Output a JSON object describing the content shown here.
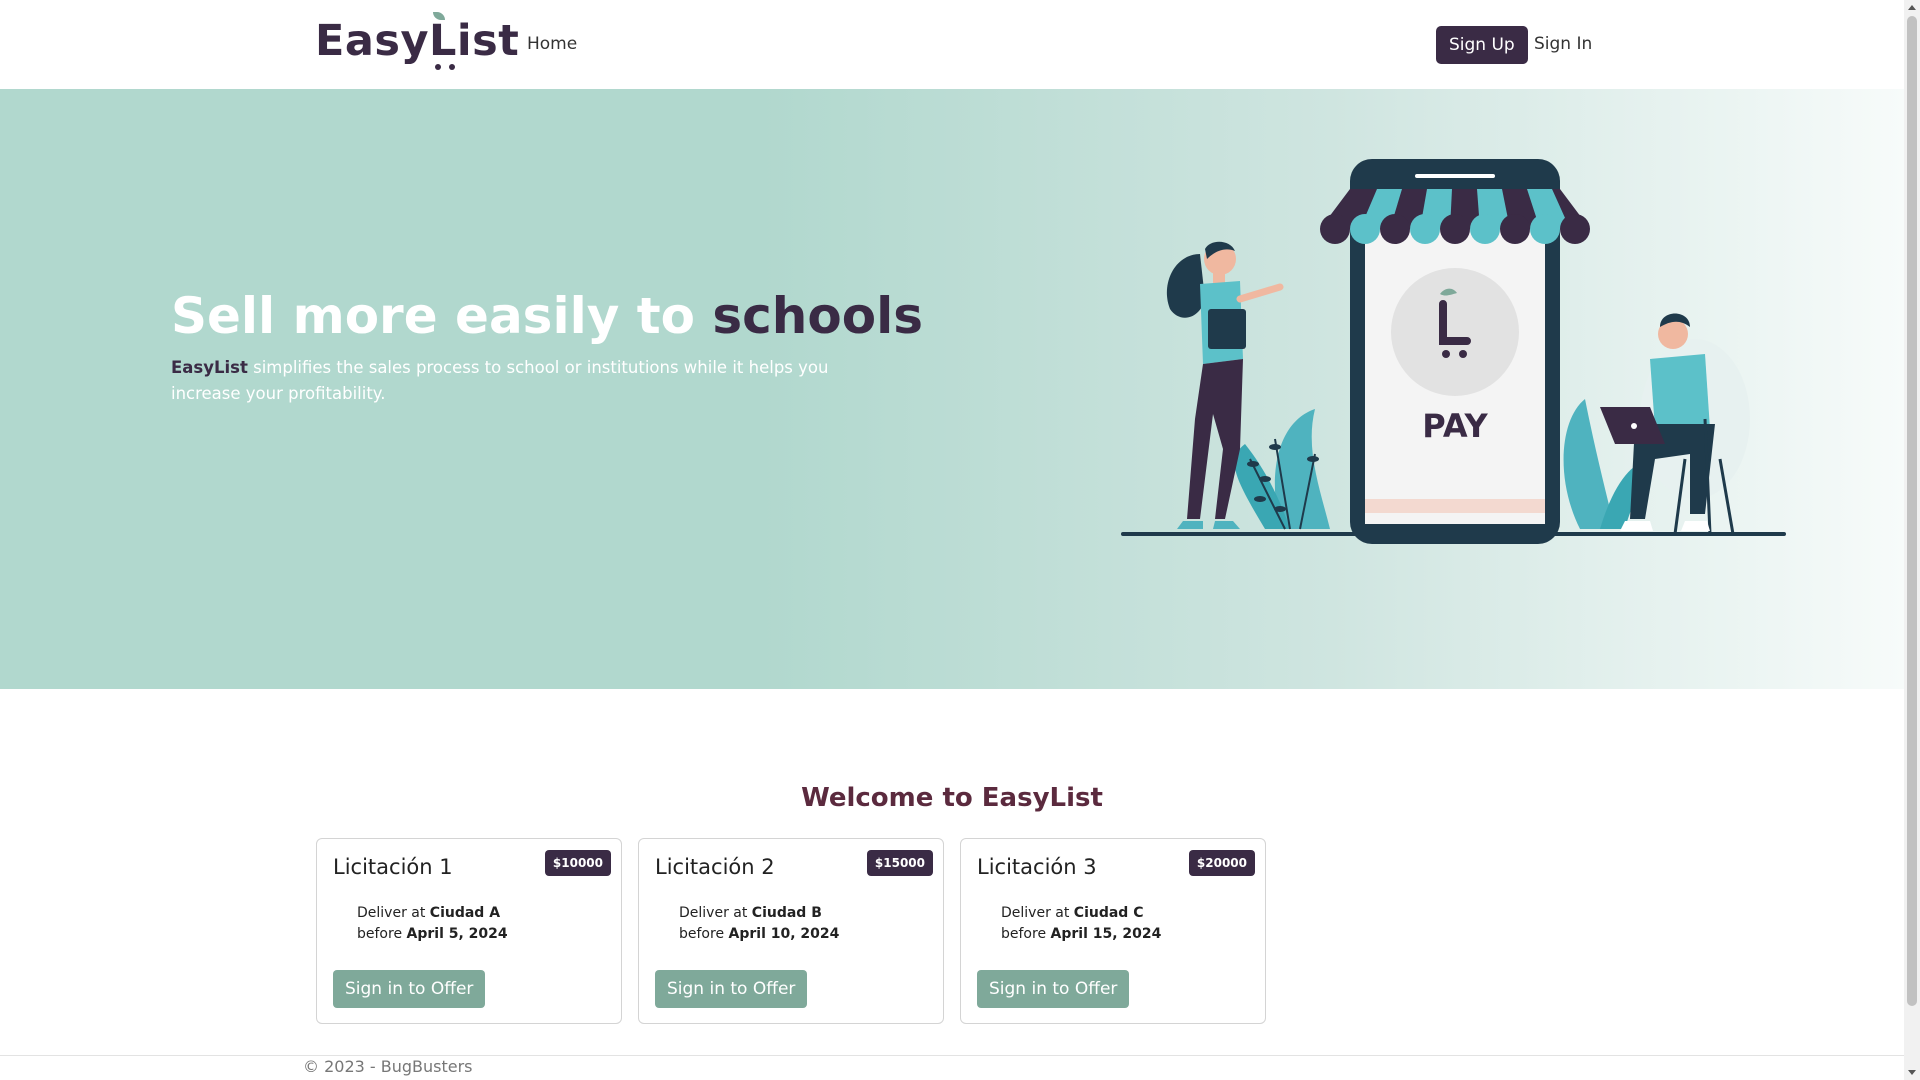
{
  "navbar": {
    "logo": "EasyList",
    "home_label": "Home",
    "signup_label": "Sign Up",
    "signin_label": "Sign In"
  },
  "hero": {
    "title_main": "Sell more easily to ",
    "title_accent": "schools",
    "subtitle_brand": "EasyList",
    "subtitle_rest": " simplifies the sales process to school or institutions while it helps you increase your profitability.",
    "illustration_text": "PAY"
  },
  "section": {
    "welcome_title": "Welcome to EasyList"
  },
  "cards": [
    {
      "title": "Licitación 1",
      "price": "$10000",
      "deliver_prefix": "Deliver at ",
      "city": "Ciudad A",
      "before_prefix": "before ",
      "date": "April 5, 2024",
      "button_label": "Sign in to Offer"
    },
    {
      "title": "Licitación 2",
      "price": "$15000",
      "deliver_prefix": "Deliver at ",
      "city": "Ciudad B",
      "before_prefix": "before ",
      "date": "April 10, 2024",
      "button_label": "Sign in to Offer"
    },
    {
      "title": "Licitación 3",
      "price": "$20000",
      "deliver_prefix": "Deliver at ",
      "city": "Ciudad C",
      "before_prefix": "before ",
      "date": "April 15, 2024",
      "button_label": "Sign in to Offer"
    }
  ],
  "footer": {
    "text": "© 2023 - BugBusters"
  },
  "colors": {
    "brand": "#3a2b45",
    "accent_green": "#7fa99a",
    "hero_bg": "#b1d8ce",
    "welcome": "#5b2a3e"
  }
}
